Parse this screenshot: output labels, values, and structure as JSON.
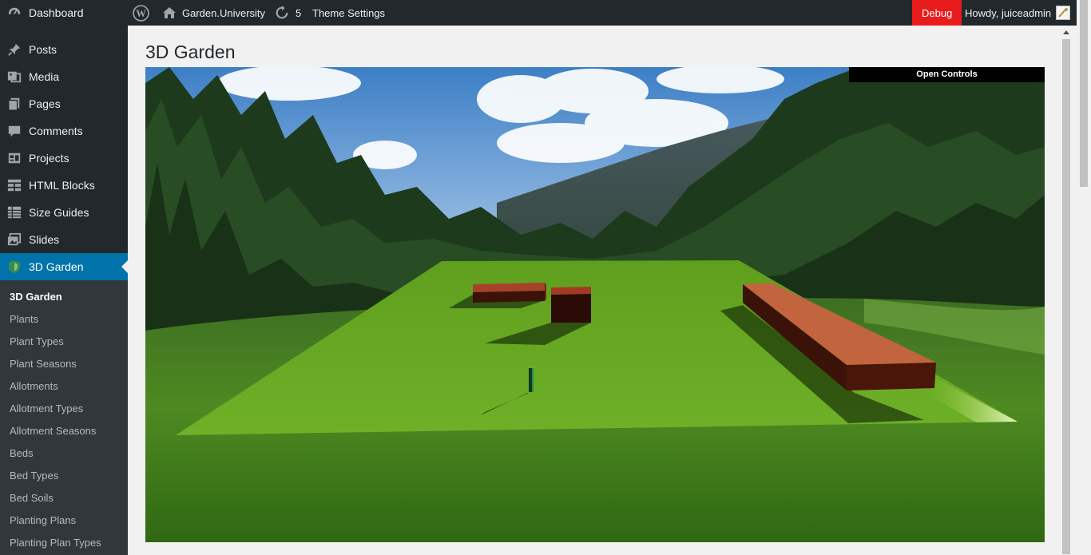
{
  "adminbar": {
    "site_name": "Garden.University",
    "updates_count": "5",
    "theme_settings": "Theme Settings",
    "debug": "Debug",
    "howdy": "Howdy, juiceadmin"
  },
  "sidebar": {
    "items": [
      {
        "label": "Dashboard",
        "icon": "dashboard-icon"
      },
      {
        "label": "Posts",
        "icon": "pin-icon"
      },
      {
        "label": "Media",
        "icon": "media-icon"
      },
      {
        "label": "Pages",
        "icon": "pages-icon"
      },
      {
        "label": "Comments",
        "icon": "comment-icon"
      },
      {
        "label": "Projects",
        "icon": "portfolio-icon"
      },
      {
        "label": "HTML Blocks",
        "icon": "blocks-icon"
      },
      {
        "label": "Size Guides",
        "icon": "table-icon"
      },
      {
        "label": "Slides",
        "icon": "slides-icon"
      },
      {
        "label": "3D Garden",
        "icon": "garden-shield-icon"
      }
    ],
    "submenu": [
      "3D Garden",
      "Plants",
      "Plant Types",
      "Plant Seasons",
      "Allotments",
      "Allotment Types",
      "Allotment Seasons",
      "Beds",
      "Bed Types",
      "Bed Soils",
      "Planting Plans",
      "Planting Plan Types"
    ]
  },
  "main": {
    "title": "3D Garden",
    "open_controls": "Open Controls"
  },
  "colors": {
    "admin_bar": "#23282d",
    "menu_active": "#0073aa",
    "debug": "#e81c1c",
    "submenu_bg": "#32373c"
  }
}
